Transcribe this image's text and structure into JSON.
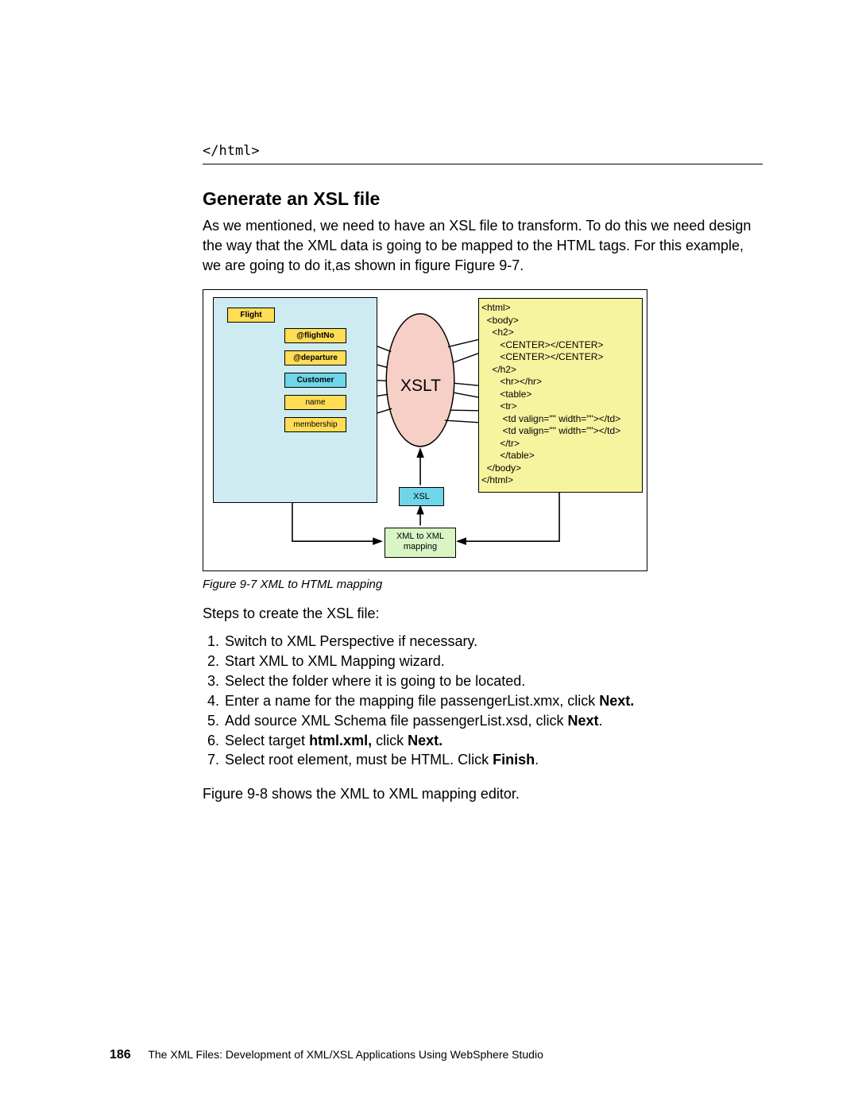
{
  "code_line": "</html>",
  "heading": "Generate an XSL file",
  "intro_para": "As we mentioned, we need to have an XSL file to transform. To do this we need design the way that the XML data is going to be mapped to the HTML tags. For this example, we are going to do it,as shown in figure Figure 9-7.",
  "figure": {
    "caption": "Figure 9-7   XML to HTML mapping",
    "xslt_label": "XSLT",
    "xsl_box": "XSL",
    "map_box_l1": "XML to XML",
    "map_box_l2": "mapping",
    "nodes": {
      "flight": "Flight",
      "flightNo": "@flightNo",
      "departure": "@departure",
      "customer": "Customer",
      "name": "name",
      "membership": "membership"
    },
    "html_code": "<html>\n  <body>\n    <h2>\n       <CENTER></CENTER>\n       <CENTER></CENTER>\n    </h2>\n       <hr></hr>\n       <table>\n       <tr>\n        <td valign=\"\" width=\"\"></td>\n        <td valign=\"\" width=\"\"></td>\n       </tr>\n       </table>\n  </body>\n</html>"
  },
  "steps_intro": "Steps to create the XSL file:",
  "steps": [
    {
      "pre": "Switch to XML Perspective if necessary."
    },
    {
      "pre": "Start XML to XML Mapping wizard."
    },
    {
      "pre": "Select the folder where it is going to be located."
    },
    {
      "pre": "Enter a name for the mapping file passengerList.xmx, click ",
      "bold": "Next."
    },
    {
      "pre": "Add source XML Schema file passengerList.xsd, click ",
      "bold": "Next",
      "post": "."
    },
    {
      "pre": "Select target ",
      "bold": "html.xml,",
      "mid": " click ",
      "bold2": "Next."
    },
    {
      "pre": "Select root element, must be HTML. Click ",
      "bold": "Finish",
      "post": "."
    }
  ],
  "closing_para": "Figure 9-8 shows the XML to XML mapping editor.",
  "footer": {
    "page": "186",
    "title": "The XML Files:   Development of XML/XSL Applications Using WebSphere Studio"
  }
}
